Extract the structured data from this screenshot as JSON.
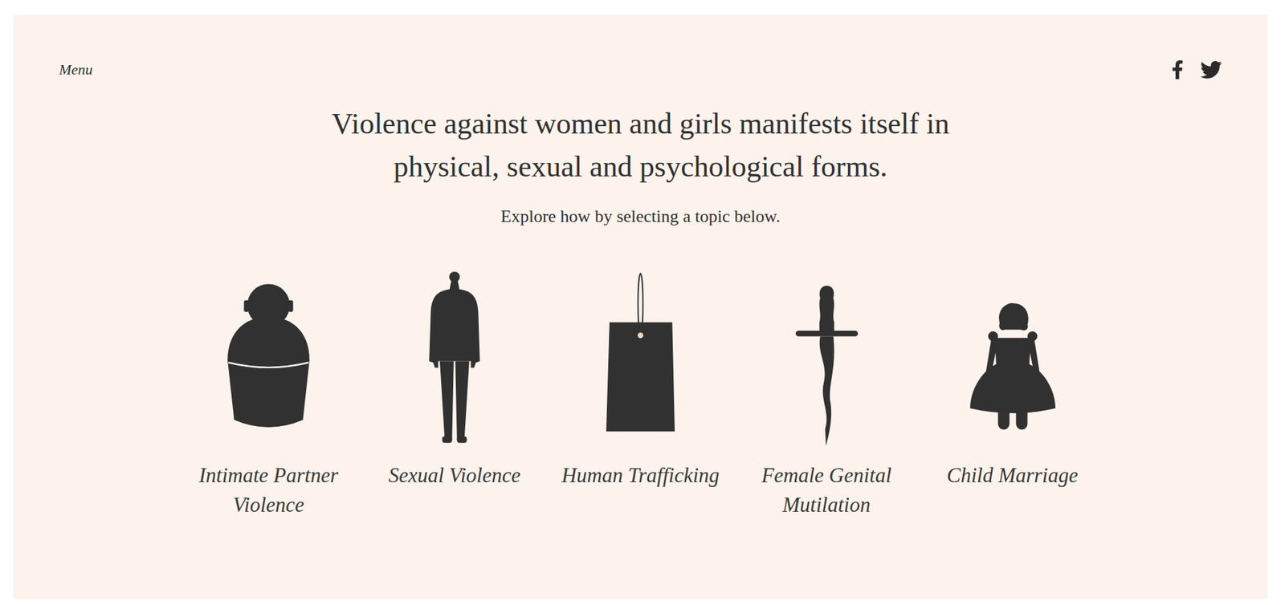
{
  "header": {
    "menu": "Menu"
  },
  "headline_lines": [
    "Violence against women and girls manifests itself in",
    "physical, sexual and psychological forms."
  ],
  "subtitle": "Explore how by selecting a topic below.",
  "topics": [
    {
      "label": "Intimate Partner Violence",
      "kind": "jar"
    },
    {
      "label": "Sexual Violence",
      "kind": "figure"
    },
    {
      "label": "Human Trafficking",
      "kind": "tag"
    },
    {
      "label": "Female Genital Mutilation",
      "kind": "dagger"
    },
    {
      "label": "Child Marriage",
      "kind": "doll"
    }
  ]
}
